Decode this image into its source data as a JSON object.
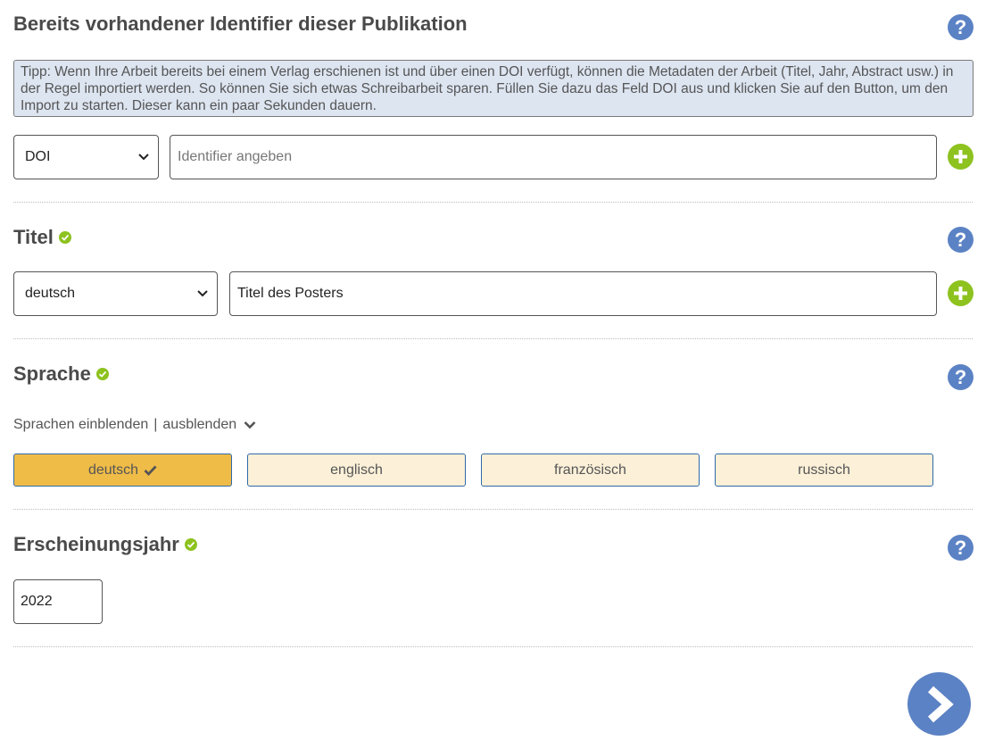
{
  "identifier_section": {
    "title": "Bereits vorhandener Identifier dieser Publikation",
    "tip": "Tipp: Wenn Ihre Arbeit bereits bei einem Verlag erschienen ist und über einen DOI verfügt, können die Metadaten der Arbeit (Titel, Jahr, Abstract usw.) in der Regel importiert werden. So können Sie sich etwas Schreibarbeit sparen. Füllen Sie dazu das Feld DOI aus und klicken Sie auf den Button, um den Import zu starten. Dieser kann ein paar Sekunden dauern.",
    "type_select": "DOI",
    "placeholder": "Identifier angeben"
  },
  "title_section": {
    "title": "Titel",
    "language_select": "deutsch",
    "value": "Titel des Posters"
  },
  "language_section": {
    "title": "Sprache",
    "toggle_show": "Sprachen einblenden",
    "toggle_sep": "|",
    "toggle_hide": "ausblenden",
    "options": [
      {
        "label": "deutsch",
        "selected": true
      },
      {
        "label": "englisch",
        "selected": false
      },
      {
        "label": "französisch",
        "selected": false
      },
      {
        "label": "russisch",
        "selected": false
      }
    ]
  },
  "year_section": {
    "title": "Erscheinungsjahr",
    "value": "2022"
  },
  "help_symbol": "?",
  "icons": [
    "help-icon",
    "plus-icon",
    "check-circle-icon",
    "chevron-down-icon",
    "next-arrow-icon"
  ],
  "colors": {
    "accent_blue": "#5b82c4",
    "ok_green": "#8dc21f",
    "selected_lang": "#efbc48",
    "lang_bg": "#fcf0d8",
    "tip_bg": "#dde5f1"
  }
}
